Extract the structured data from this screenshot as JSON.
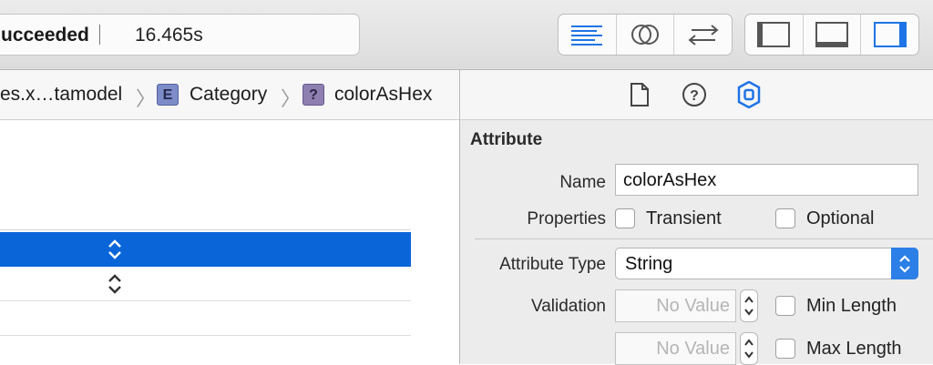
{
  "toolbar": {
    "status": "ucceeded",
    "elapsed": "16.465s",
    "editor_buttons": [
      {
        "name": "standard-editor-icon",
        "active": true
      },
      {
        "name": "assistant-editor-icon",
        "active": false
      },
      {
        "name": "version-editor-icon",
        "active": false
      }
    ],
    "view_buttons": [
      {
        "name": "navigator-panel-icon",
        "active": false
      },
      {
        "name": "debug-panel-icon",
        "active": false
      },
      {
        "name": "utilities-panel-icon",
        "active": true
      }
    ]
  },
  "jumpbar": {
    "file": "es.x…tamodel",
    "entity_badge": "E",
    "entity": "Category",
    "attr_badge": "?",
    "attribute": "colorAsHex"
  },
  "inspector": {
    "tabs": [
      "file-inspector-icon",
      "quick-help-icon",
      "data-model-inspector-icon"
    ],
    "section_title": "Attribute",
    "name_label": "Name",
    "name_value": "colorAsHex",
    "properties_label": "Properties",
    "transient_label": "Transient",
    "optional_label": "Optional",
    "attribute_type_label": "Attribute Type",
    "attribute_type_value": "String",
    "validation_label": "Validation",
    "min_placeholder": "No Value",
    "max_placeholder": "No Value",
    "min_length_label": "Min Length",
    "max_length_label": "Max Length"
  },
  "colors": {
    "selection": "#0a66d8",
    "accent": "#2c7fe6"
  }
}
